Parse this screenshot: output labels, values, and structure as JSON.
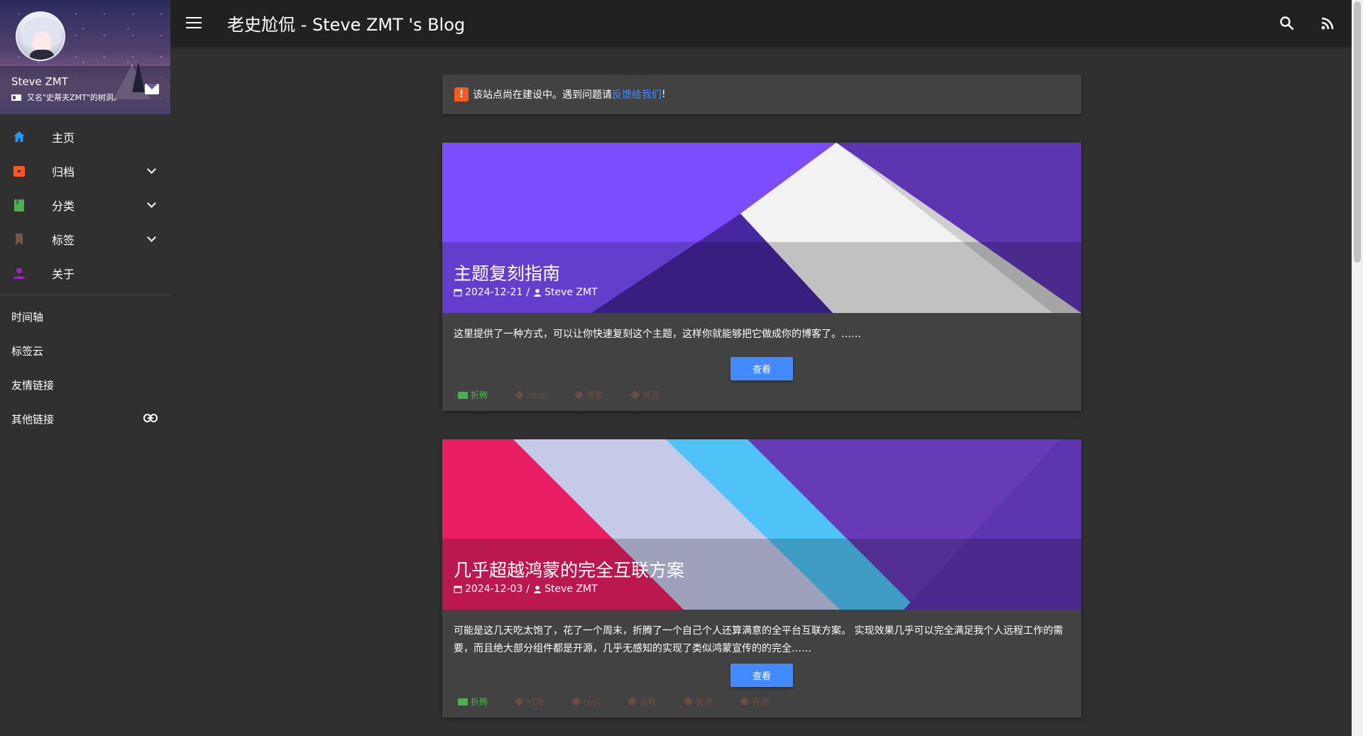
{
  "topbar": {
    "title": "老史尬侃 - Steve ZMT 's Blog"
  },
  "sidebar": {
    "owner_name": "Steve ZMT",
    "owner_desc": "又名\"史蒂夫ZMT\"的树洞。",
    "nav": [
      {
        "label": "主页",
        "icon": "home-icon",
        "color": "#2196f3",
        "expandable": false
      },
      {
        "label": "归档",
        "icon": "archive-icon",
        "color": "#ff5722",
        "expandable": true
      },
      {
        "label": "分类",
        "icon": "book-icon",
        "color": "#4caf50",
        "expandable": true
      },
      {
        "label": "标签",
        "icon": "bookmark-icon",
        "color": "#795548",
        "expandable": true
      },
      {
        "label": "关于",
        "icon": "person-icon",
        "color": "#9c27b0",
        "expandable": false
      }
    ],
    "extra": [
      {
        "label": "时间轴"
      },
      {
        "label": "标签云"
      },
      {
        "label": "友情链接"
      },
      {
        "label": "其他链接",
        "icon": "link-icon"
      }
    ]
  },
  "notice": {
    "text_before": "该站点尚在建设中。遇到问题请",
    "link_text": "反馈给我们",
    "text_after": "!"
  },
  "posts": [
    {
      "title": "主题复刻指南",
      "date": "2024-12-21",
      "separator": "/",
      "author": "Steve ZMT",
      "excerpt": "这里提供了一种方式，可以让你快速复刻这个主题，这样你就能够把它做成你的博客了。……",
      "button": "查看",
      "category": "折腾",
      "tags": [
        "hexo",
        "博客",
        "开源"
      ]
    },
    {
      "title": "几乎超越鸿蒙的完全互联方案",
      "date": "2024-12-03",
      "separator": "/",
      "author": "Steve ZMT",
      "excerpt": "可能是这几天吃太饱了，花了一个周末，折腾了一个自己个人还算满意的全平台互联方案。 实现效果几乎可以完全满足我个人远程工作的需要，而且绝大部分组件都是开源，几乎无感知的实现了类似鸿蒙宣传的的完全……",
      "button": "查看",
      "category": "折腾",
      "tags": [
        "KDE",
        "root",
        "互联",
        "安卓",
        "开源"
      ]
    }
  ],
  "colors": {
    "accent": "#448aff",
    "notice_icon": "#ff5722",
    "category": "#4caf50",
    "tag": "#6d4c41",
    "background": "#303030",
    "card": "#424242",
    "topbar": "#212121"
  }
}
